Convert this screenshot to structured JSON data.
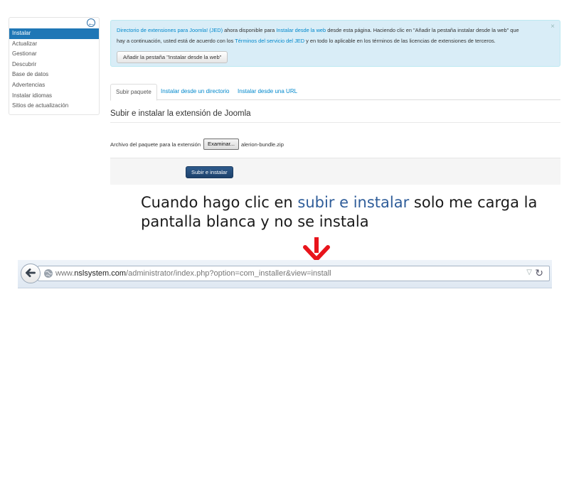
{
  "sidebar": {
    "items": [
      {
        "label": "Instalar",
        "active": true
      },
      {
        "label": "Actualizar"
      },
      {
        "label": "Gestionar"
      },
      {
        "label": "Descubrir"
      },
      {
        "label": "Base de datos"
      },
      {
        "label": "Advertencias"
      },
      {
        "label": "Instalar idiomas"
      },
      {
        "label": "Sitios de actualización"
      }
    ],
    "collapse_icon": "circle-arrow-left-icon"
  },
  "alert": {
    "jed_link": "Directorio de extensiones para Joomla! (JED)",
    "text1": " ahora disponible para ",
    "install_web_link": "Instalar desde la web",
    "text2": " desde esta página.  Haciendo clic en \"Añadir la pestaña instalar desde la web\" que",
    "text3": "hay a continuación, usted está de acuerdo con los ",
    "terms_link": "Términos del servicio del JED",
    "text4": " y en todo lo aplicable en los términos de las licencias de extensiones de terceros.",
    "close": "×",
    "button": "Añadir la pestaña \"Instalar desde la web\""
  },
  "tabs": [
    {
      "label": "Subir paquete",
      "active": true
    },
    {
      "label": "Instalar desde un directorio"
    },
    {
      "label": "Instalar desde una URL"
    }
  ],
  "upload": {
    "title": "Subir e instalar la extensión de Joomla",
    "file_label": "Archivo del paquete para la extensión",
    "browse_button": "Examinar...",
    "file_name": "alerion-bundle.zip",
    "submit_button": "Subir e instalar"
  },
  "annotation": {
    "before": "Cuando hago clic en ",
    "highlight": "subir e instalar",
    "after": " solo me carga la pantalla blanca y no se instala",
    "arrow_color": "#e8141b",
    "highlight_color": "#2f5d99"
  },
  "browser": {
    "url_prefix": "www.",
    "url_domain": "nslsystem.com",
    "url_path": "/administrator/index.php?option=com_installer&view=install",
    "back_icon": "back-arrow-icon",
    "site_icon": "globe-icon",
    "reload_icon": "reload-icon"
  },
  "colors": {
    "accent": "#1f77b6",
    "link": "#0088cc",
    "alert_bg": "#d9edf7",
    "primary_button": "#2f5b8c"
  }
}
